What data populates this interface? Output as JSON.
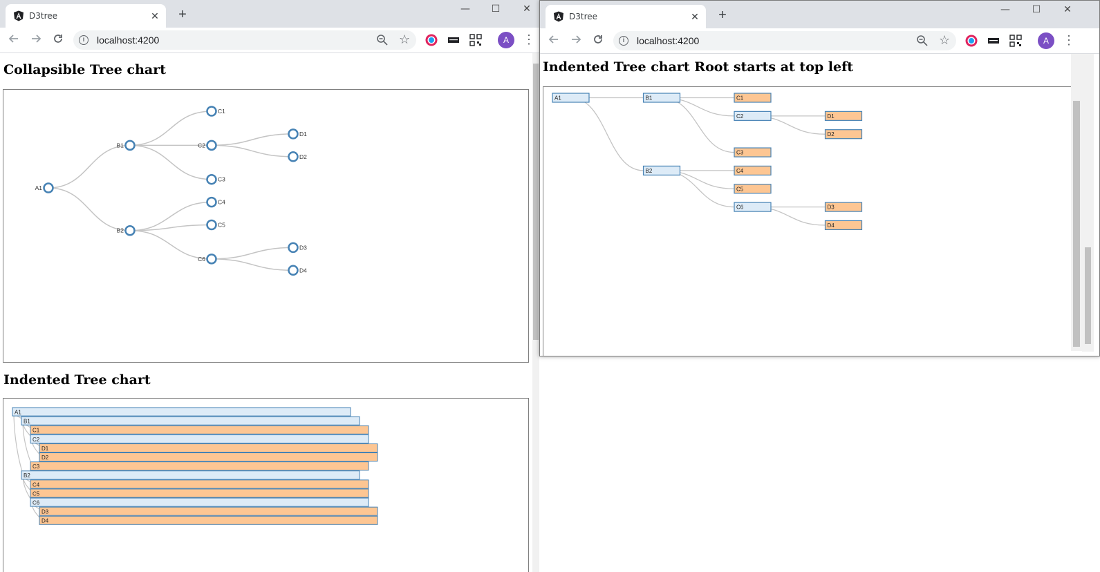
{
  "left_window": {
    "tab_title": "D3tree",
    "url": "localhost:4200",
    "avatar_letter": "A",
    "heading_collapsible": "Collapsible Tree chart",
    "heading_indented": "Indented Tree chart"
  },
  "right_window": {
    "tab_title": "D3tree",
    "url": "localhost:4200",
    "avatar_letter": "A",
    "heading": "Indented Tree chart Root starts at top left"
  },
  "window_controls": {
    "minimize": "—",
    "maximize": "☐",
    "close": "✕"
  },
  "icons": {
    "back": "arrow-left-icon",
    "forward": "arrow-right-icon",
    "reload": "reload-icon",
    "info": "info-icon",
    "zoom": "zoom-out-icon",
    "star": "star-icon",
    "menu": "three-dots-icon",
    "tab": "angular-logo-icon",
    "close": "close-icon",
    "new_tab": "plus-icon"
  },
  "colors": {
    "node_stroke": "#4682b4",
    "internal_fill": "#ddebf7",
    "leaf_fill": "#fdc693",
    "link": "#c4c4c4",
    "avatar": "#7b4fc4"
  },
  "chart_data": [
    {
      "type": "tree",
      "title": "Collapsible Tree chart",
      "tree": {
        "name": "A1",
        "children": [
          {
            "name": "B1",
            "children": [
              {
                "name": "C1"
              },
              {
                "name": "C2",
                "children": [
                  {
                    "name": "D1"
                  },
                  {
                    "name": "D2"
                  }
                ]
              },
              {
                "name": "C3"
              }
            ]
          },
          {
            "name": "B2",
            "children": [
              {
                "name": "C4"
              },
              {
                "name": "C5"
              },
              {
                "name": "C6",
                "children": [
                  {
                    "name": "D3"
                  },
                  {
                    "name": "D4"
                  }
                ]
              }
            ]
          }
        ]
      }
    },
    {
      "type": "tree",
      "title": "Indented Tree chart",
      "rows": [
        "A1",
        "B1",
        "C1",
        "C2",
        "D1",
        "D2",
        "C3",
        "B2",
        "C4",
        "C5",
        "C6",
        "D3",
        "D4"
      ]
    },
    {
      "type": "tree",
      "title": "Indented Tree chart Root starts at top left",
      "rows": [
        "A1",
        "B1",
        "C1",
        "C2",
        "D1",
        "D2",
        "C3",
        "B2",
        "C4",
        "C5",
        "C6",
        "D3",
        "D4"
      ]
    }
  ]
}
